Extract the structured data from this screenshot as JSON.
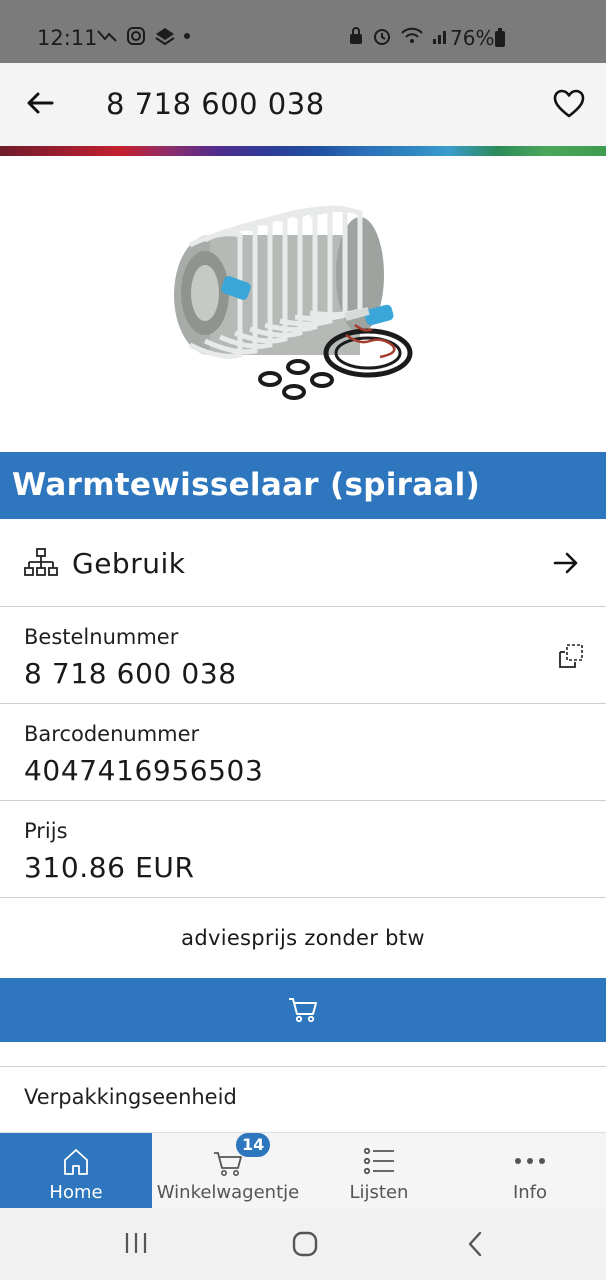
{
  "status_bar": {
    "time": "12:11",
    "battery": "76%"
  },
  "app_bar": {
    "title": "8 718 600 038"
  },
  "product": {
    "image_alt": "Warmtewisselaar (spiraal)",
    "title": "Warmtewisselaar (spiraal)"
  },
  "usage": {
    "label": "Gebruik"
  },
  "fields": {
    "order_number": {
      "label": "Bestelnummer",
      "value": "8 718 600 038"
    },
    "barcode": {
      "label": "Barcodenummer",
      "value": "4047416956503"
    },
    "price": {
      "label": "Prijs",
      "value": "310.86 EUR"
    }
  },
  "price_note": "adviesprijs zonder btw",
  "packaging": {
    "label": "Verpakkingseenheid"
  },
  "bottom_nav": {
    "items": [
      {
        "label": "Home",
        "icon": "home-icon",
        "active": true
      },
      {
        "label": "Winkelwagentje",
        "icon": "cart-icon",
        "badge": "14"
      },
      {
        "label": "Lijsten",
        "icon": "list-icon"
      },
      {
        "label": "Info",
        "icon": "more-icon"
      }
    ]
  },
  "colors": {
    "accent": "#2e77be",
    "status_bar": "#7b7b7b"
  }
}
